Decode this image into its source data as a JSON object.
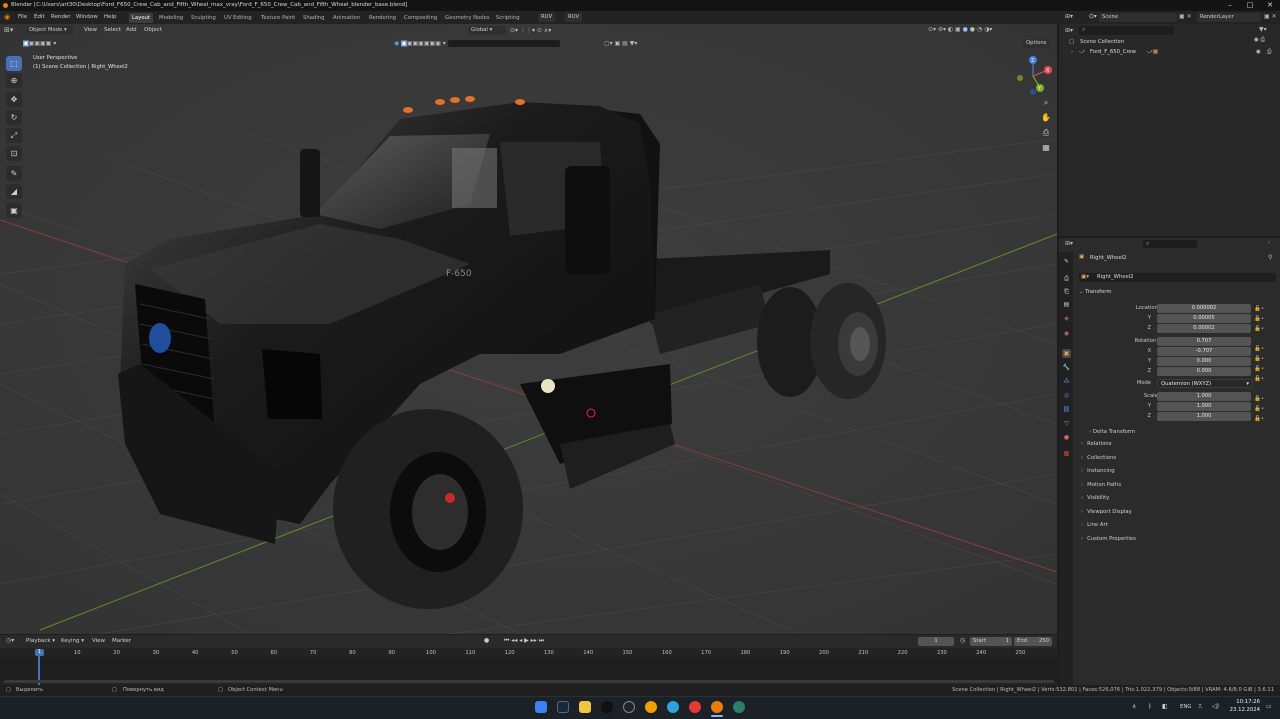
{
  "title_bar": {
    "text": "Blender [C:\\Users\\art30\\Desktop\\Ford_F650_Crew_Cab_and_Fifth_Wheel_max_vray\\Ford_F_650_Crew_Cab_and_Fifth_Wheel_blender_base.blend]"
  },
  "menus": [
    "File",
    "Edit",
    "Render",
    "Window",
    "Help"
  ],
  "workspaces": [
    "Layout",
    "Modeling",
    "Sculpting",
    "UV Editing",
    "Texture Paint",
    "Shading",
    "Animation",
    "Rendering",
    "Compositing",
    "Geometry Nodes",
    "Scripting"
  ],
  "ruv": [
    "RUV",
    "RUV"
  ],
  "scene_field": "Scene",
  "render_layer_field": "RenderLayer",
  "viewport": {
    "mode": "Object Mode",
    "menus": [
      "View",
      "Select",
      "Add",
      "Object"
    ],
    "orientation": "Global",
    "options": "Options",
    "perspective": "User Perspective",
    "collection_path": "(1) Scene Collection | Right_Wheel2",
    "decal_text": "F-650",
    "gizmo": {
      "x": "X",
      "y": "Y",
      "z": "Z"
    }
  },
  "outliner": {
    "root": "Scene Collection",
    "items": [
      "Ford_F_650_Crew"
    ]
  },
  "properties": {
    "object_name": "Right_Wheel2",
    "data_name": "Right_Wheel2",
    "transform_title": "Transform",
    "location": {
      "label": "Location X",
      "x": "0.000002",
      "y": "0.00005",
      "z": "0.00002"
    },
    "rotation": {
      "label": "Rotation W",
      "w": "0.707",
      "x": "-0.707",
      "y": "0.000",
      "z": "0.000"
    },
    "mode_label": "Mode",
    "mode_value": "Quaternion (WXYZ)",
    "scale": {
      "label": "Scale X",
      "x": "1.000",
      "y": "1.000",
      "z": "1.000"
    },
    "axis_labels": {
      "x": "X",
      "y": "Y",
      "z": "Z",
      "w": "W"
    },
    "delta": "Delta Transform",
    "sections": [
      "Relations",
      "Collections",
      "Instancing",
      "Motion Paths",
      "Visibility",
      "Viewport Display",
      "Line Art",
      "Custom Properties"
    ]
  },
  "timeline": {
    "menus": [
      "Playback",
      "Keying",
      "View",
      "Marker"
    ],
    "current_frame": "1",
    "start_label": "Start",
    "start": "1",
    "end_label": "End",
    "end": "250",
    "ticks": [
      "10",
      "20",
      "30",
      "40",
      "50",
      "60",
      "70",
      "80",
      "90",
      "100",
      "110",
      "120",
      "130",
      "140",
      "150",
      "160",
      "170",
      "180",
      "190",
      "200",
      "210",
      "220",
      "230",
      "240",
      "250"
    ],
    "playhead": "1"
  },
  "status_bar": {
    "left1": "Выделить",
    "left2": "Повернуть вид",
    "left3": "Object Context Menu",
    "right": "Scene Collection | Right_Wheel2 | Verts:532,801 | Faces:526,076 | Tris:1,022,379 | Objects:0/88 | VRAM: 4.6/8.0 GiB | 3.6.11"
  },
  "taskbar": {
    "lang": "ENG",
    "time": "10:17:26",
    "date": "23.12.2024"
  },
  "colors": {
    "accent": "#4772b3",
    "orange": "#e87d0d",
    "panel": "#282828",
    "field": "#545454",
    "selected_row": "#4772b3"
  }
}
